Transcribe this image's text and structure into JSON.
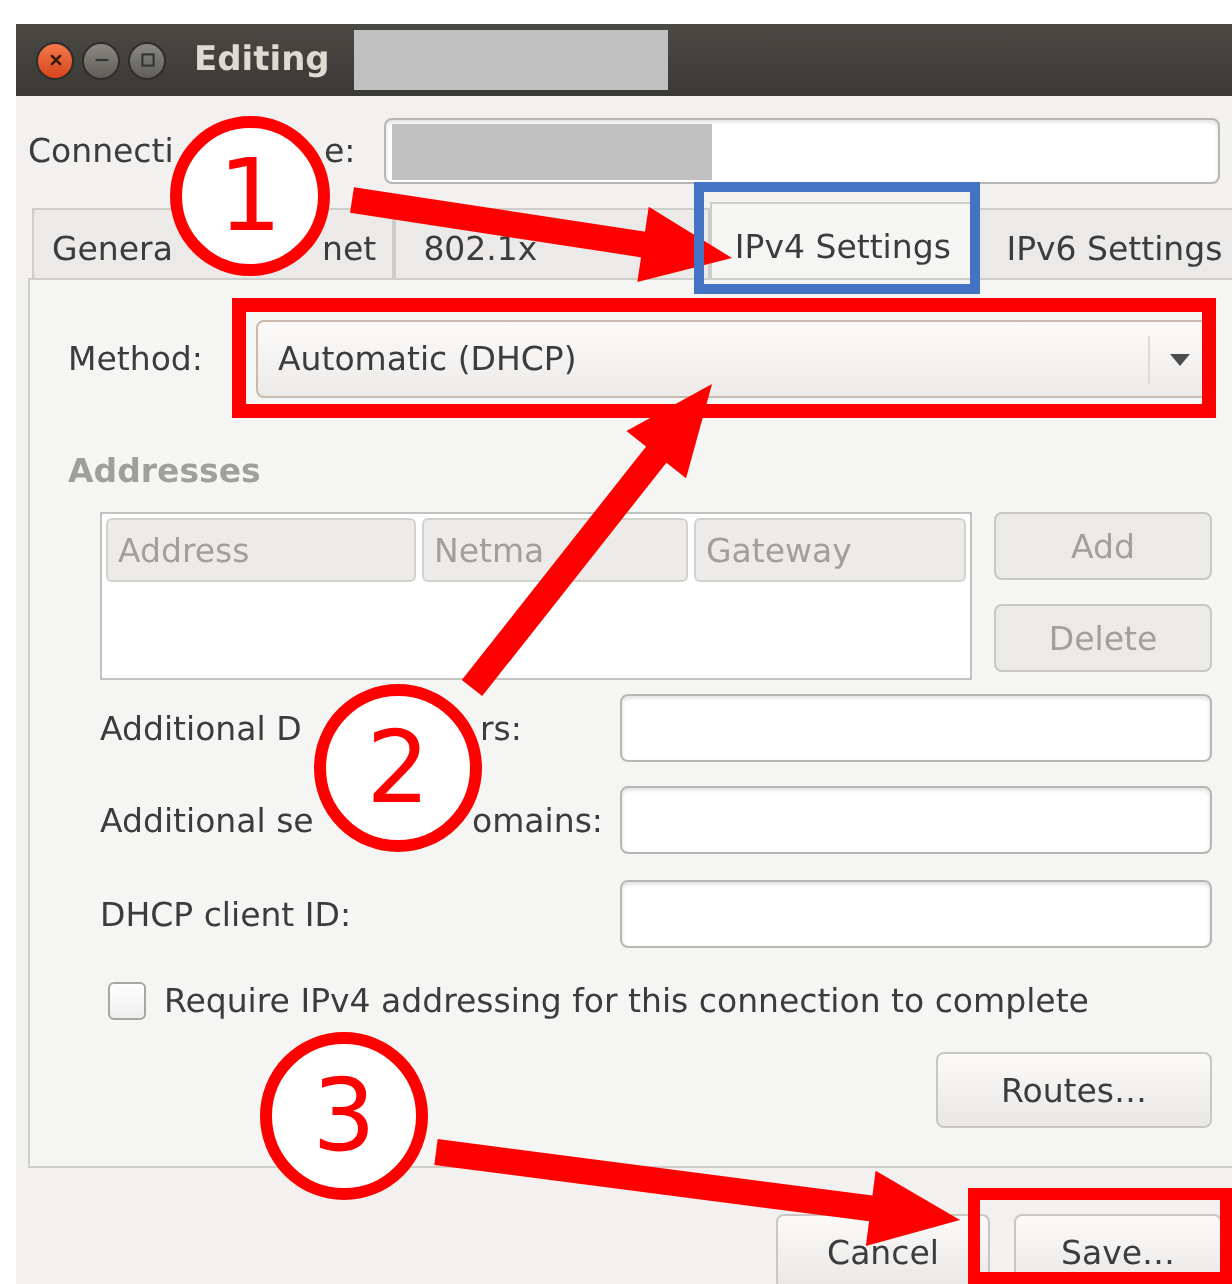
{
  "window": {
    "title": "Editing"
  },
  "connection_name": {
    "label_parts": [
      "Connecti",
      "e:"
    ]
  },
  "tabs": [
    {
      "parts": [
        "Genera",
        "net"
      ],
      "selected": false
    },
    {
      "parts": [
        "802.1x"
      ],
      "selected": false
    },
    {
      "parts": [
        "IPv4 Settings"
      ],
      "selected": true
    },
    {
      "parts": [
        "IPv6 Settings"
      ],
      "selected": false
    }
  ],
  "method": {
    "label": "Method:",
    "value": "Automatic (DHCP)"
  },
  "addresses": {
    "heading": "Addresses",
    "disabled": true,
    "columns": [
      "Address",
      "Netma",
      "Gateway"
    ],
    "buttons": [
      {
        "label": "Add",
        "disabled": true
      },
      {
        "label": "Delete",
        "disabled": true
      }
    ]
  },
  "fields": [
    {
      "label_parts": [
        "Additional D",
        "rs:"
      ]
    },
    {
      "label_parts": [
        "Additional se",
        "omains:"
      ]
    },
    {
      "label_parts": [
        "DHCP client ID:"
      ]
    }
  ],
  "require_checkbox": {
    "label": "Require IPv4 addressing for this connection to complete",
    "checked": false
  },
  "routes_button": "Routes…",
  "buttons": [
    "Cancel",
    "Save…"
  ],
  "annotations": {
    "steps": [
      "1",
      "2",
      "3"
    ],
    "frames": [
      {
        "color": "#4472c4"
      },
      {
        "color": "#ff0000"
      },
      {
        "color": "#ff0000"
      }
    ]
  }
}
